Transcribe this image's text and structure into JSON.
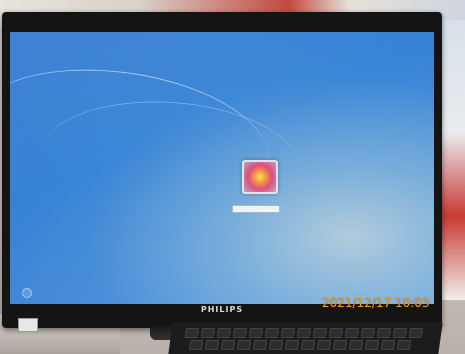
{
  "photo": {
    "subject": "monitor-login-screen",
    "timestamp": "2021/12/17 10:03",
    "monitor_brand": "PHILIPS",
    "colors": {
      "screen_blue": "#3b86d6",
      "timestamp_orange": "#ff9a1a",
      "bezel": "#141414"
    },
    "login_screen": {
      "user_tile_icon": "flower-icon",
      "ease_of_access_icon": "ease-of-access-icon",
      "submit_icon": "arrow-right-icon"
    }
  }
}
